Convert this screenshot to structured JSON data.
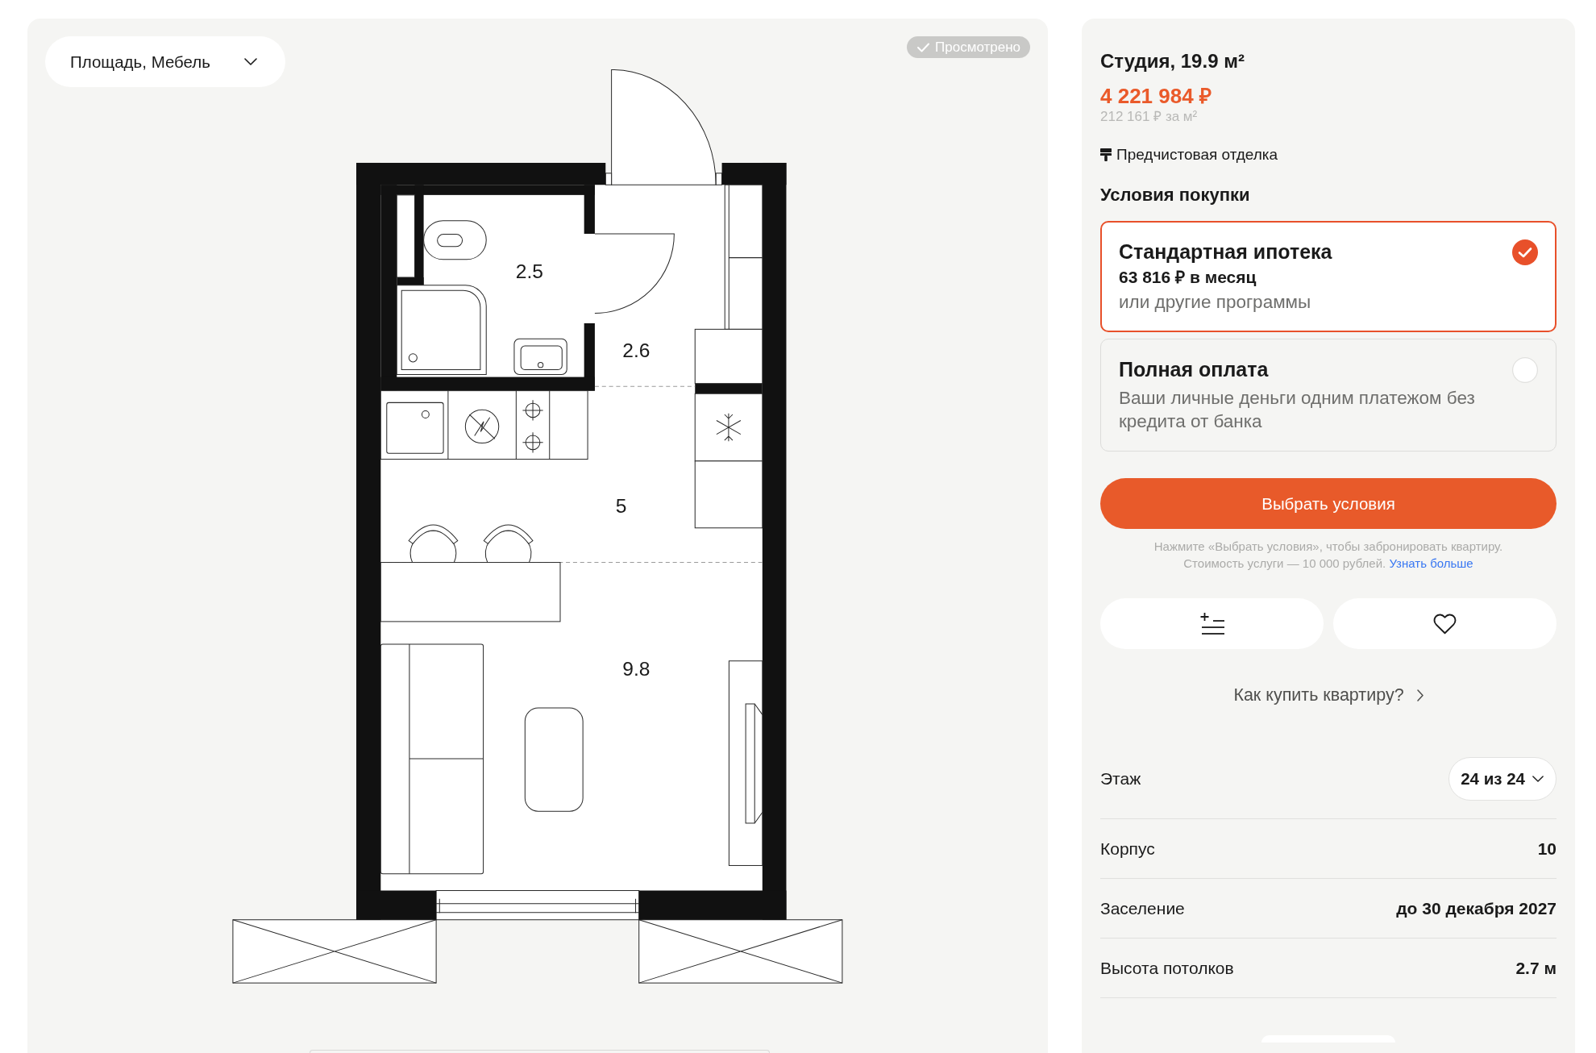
{
  "plan_view": {
    "filter_dropdown": {
      "label": "Площадь, Мебель"
    },
    "viewed_badge": {
      "label": "Просмотрено"
    },
    "floor_plan": {
      "rooms": [
        {
          "area": "2.5"
        },
        {
          "area": "2.6"
        },
        {
          "area": "5"
        },
        {
          "area": "9.8"
        }
      ]
    }
  },
  "listing": {
    "title": "Студия, 19.9 м²",
    "price": "4 221 984 ₽",
    "price_per_m2": "212 161 ₽ за м²",
    "finish": "Предчистовая отделка",
    "conditions_heading": "Условия покупки",
    "purchase_options": [
      {
        "title": "Стандартная ипотека",
        "monthly": "63 816 ₽ в месяц",
        "description": "или другие программы",
        "selected": true
      },
      {
        "title": "Полная оплата",
        "description": "Ваши личные деньги одним платежом без кредита от банка",
        "selected": false
      }
    ],
    "choose_button": "Выбрать условия",
    "booking_note": {
      "text": "Нажмите «Выбрать условия», чтобы забронировать квартиру. Стоимость услуги — 10 000 рублей.",
      "link": "Узнать больше"
    },
    "how_to_buy_link": "Как купить квартиру?",
    "details": [
      {
        "label": "Этаж",
        "value": "24 из 24",
        "kind": "dropdown"
      },
      {
        "label": "Корпус",
        "value": "10",
        "kind": "text"
      },
      {
        "label": "Заселение",
        "value": "до 30 декабря 2027",
        "kind": "text"
      },
      {
        "label": "Высота потолков",
        "value": "2.7 м",
        "kind": "text"
      }
    ]
  }
}
